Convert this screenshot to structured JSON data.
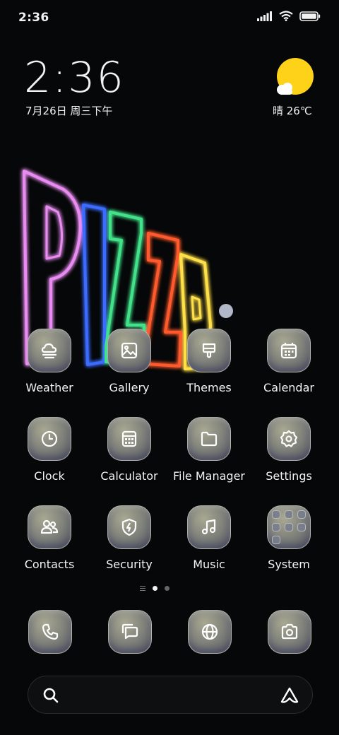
{
  "status_bar": {
    "time": "2:36",
    "icons": [
      "signal-icon",
      "wifi-icon",
      "battery-icon"
    ]
  },
  "clock_widget": {
    "time": "2:36",
    "date": "7月26日 周三下午"
  },
  "weather_widget": {
    "icon": "sunny-cloud-icon",
    "text": "晴 26℃"
  },
  "wallpaper": {
    "text": "PIZZA"
  },
  "apps": [
    {
      "label": "Weather",
      "icon": "weather-icon"
    },
    {
      "label": "Gallery",
      "icon": "gallery-icon"
    },
    {
      "label": "Themes",
      "icon": "themes-icon"
    },
    {
      "label": "Calendar",
      "icon": "calendar-icon"
    },
    {
      "label": "Clock",
      "icon": "clock-icon"
    },
    {
      "label": "Calculator",
      "icon": "calculator-icon"
    },
    {
      "label": "File Manager",
      "icon": "folder-icon"
    },
    {
      "label": "Settings",
      "icon": "gear-icon"
    },
    {
      "label": "Contacts",
      "icon": "contacts-icon"
    },
    {
      "label": "Security",
      "icon": "shield-icon"
    },
    {
      "label": "Music",
      "icon": "music-icon"
    },
    {
      "label": "System",
      "icon": "folder-grid-icon"
    }
  ],
  "page_indicator": {
    "pages": 2,
    "current": 1
  },
  "dock": [
    {
      "icon": "phone-icon"
    },
    {
      "icon": "messages-icon"
    },
    {
      "icon": "browser-icon"
    },
    {
      "icon": "camera-icon"
    }
  ],
  "search_bar": {
    "left_icon": "search-icon",
    "right_icon": "assistant-icon"
  },
  "colors": {
    "background": "#060708",
    "sun": "#ffd21a",
    "text": "#f2f2f2"
  }
}
